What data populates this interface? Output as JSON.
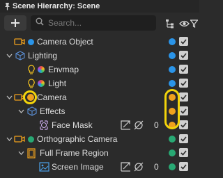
{
  "header": {
    "title": "Scene Hierarchy: Scene"
  },
  "toolbar": {
    "add_label": "+",
    "search_placeholder": "Search..."
  },
  "colors": {
    "blue": "#2a94e8",
    "orange": "#f0a11d",
    "green": "#28a873",
    "highlight": "#f2d40b"
  },
  "rows": [
    {
      "label": "Camera Object",
      "icon": "camera-icon",
      "status_color": "blue",
      "visible": true
    },
    {
      "label": "Lighting",
      "icon": "cube-icon",
      "expanded": true,
      "status_color": "blue",
      "visible": true
    },
    {
      "label": "Envmap",
      "icon": "light-bulb-icon",
      "status_color": "blue",
      "visible": true
    },
    {
      "label": "Light",
      "icon": "light-bulb-icon",
      "status_color": "blue",
      "visible": true
    },
    {
      "label": "Camera",
      "icon": "camera-icon",
      "expanded": true,
      "status_color": "orange",
      "visible": true
    },
    {
      "label": "Effects",
      "icon": "cube-icon",
      "expanded": true,
      "status_color": "orange",
      "visible": true
    },
    {
      "label": "Face Mask",
      "icon": "face-mask-icon",
      "count": "0",
      "status_color": "orange",
      "visible": true
    },
    {
      "label": "Orthographic Camera",
      "icon": "camera-icon",
      "expanded": true,
      "status_color": "green",
      "visible": true
    },
    {
      "label": "Full Frame Region",
      "icon": "region-icon",
      "expanded": true,
      "status_color": "green",
      "visible": true
    },
    {
      "label": "Screen Image",
      "icon": "image-icon",
      "count": "0",
      "status_color": "green",
      "visible": true
    }
  ]
}
